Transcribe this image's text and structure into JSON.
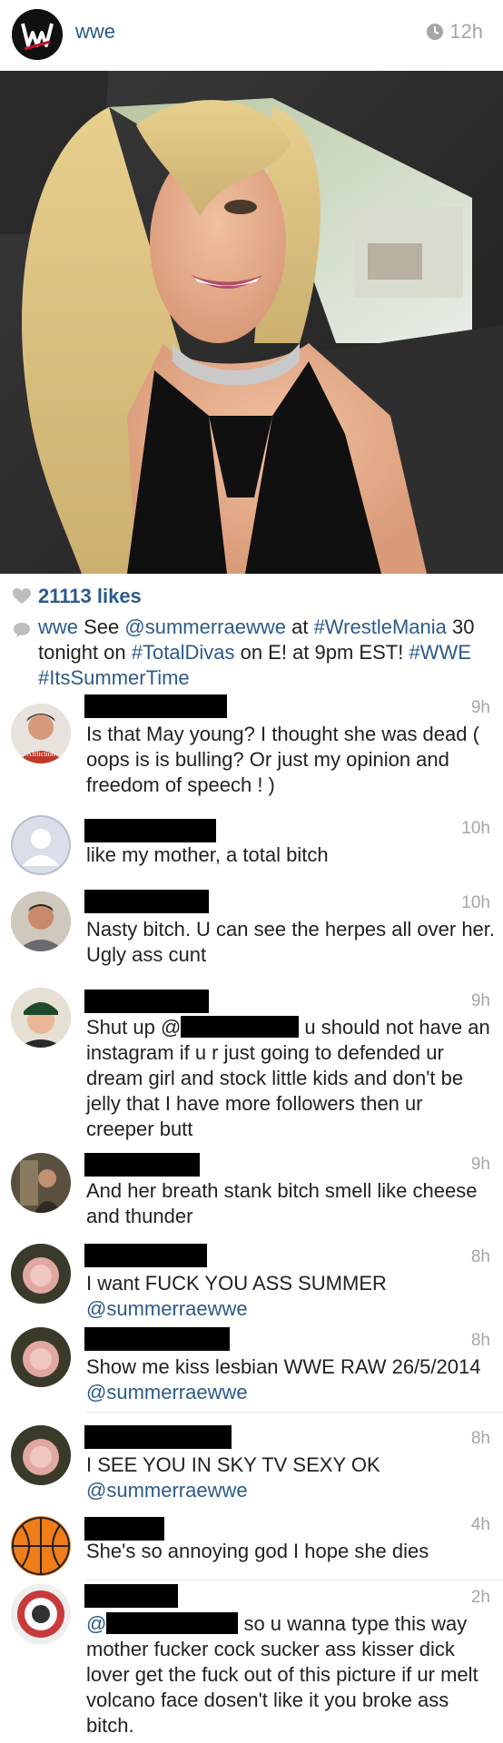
{
  "header": {
    "username": "wwe",
    "time": "12h",
    "logo_icon": "wwe-logo-icon",
    "clock_icon": "clock-icon"
  },
  "photo": {
    "icon": "selfie-photo"
  },
  "likes": {
    "text": "21113 likes",
    "icon": "heart-icon"
  },
  "caption": {
    "user": "wwe",
    "pre": " See ",
    "mention": "@summerraewwe",
    "mid1": " at ",
    "tag1": "#WrestleMania",
    "mid2": " 30 tonight on ",
    "tag2": "#TotalDivas",
    "mid3": " on E! at 9pm EST! ",
    "tag3": "#WWE",
    "space": " ",
    "tag4": "#ItsSummerTime"
  },
  "comments": [
    {
      "time": "9h",
      "text": "Is that May young? I thought she was dead ( oops is is bulling? Or just my opinion and freedom of speech ! )"
    },
    {
      "time": "10h",
      "text": "like my mother, a total bitch"
    },
    {
      "time": "10h",
      "text": "Nasty bitch. U can see the herpes all over her. Ugly ass cunt"
    },
    {
      "time": "9h",
      "pre": "Shut up @",
      "text": " u should not have an instagram if u r just going to defended ur dream girl and stock little kids and don't be jelly that I have more followers then ur creeper butt"
    },
    {
      "time": "9h",
      "text": "And her breath stank bitch smell like cheese and thunder"
    },
    {
      "time": "8h",
      "text": "I want FUCK YOU ASS SUMMER",
      "mention": "@summerraewwe"
    },
    {
      "time": "8h",
      "text": "Show me kiss lesbian WWE RAW 26/5/2014 ",
      "mention": "@summerraewwe"
    },
    {
      "time": "8h",
      "text": "I SEE YOU IN SKY TV SEXY OK",
      "mention": "@summerraewwe"
    },
    {
      "time": "4h",
      "text": "She's so annoying god I hope she dies"
    },
    {
      "time": "2h",
      "pre": "@",
      "text": " so u wanna type this way mother fucker cock sucker ass kisser dick lover get the fuck out of this picture if ur melt volcano face dosen't like it you broke ass bitch."
    }
  ]
}
